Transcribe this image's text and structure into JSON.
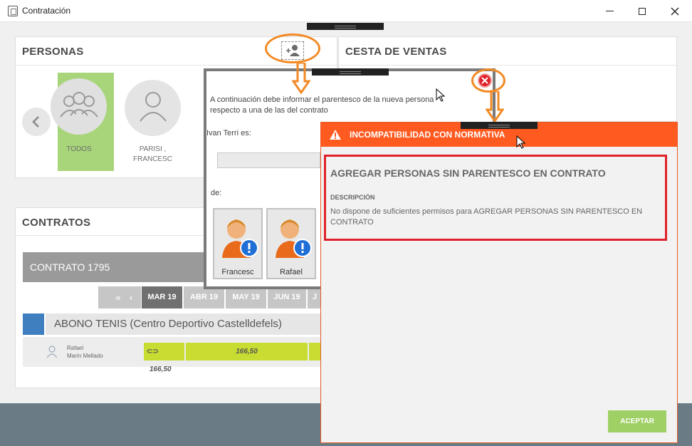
{
  "window": {
    "title": "Contratación",
    "minimize_icon": "minimize-icon",
    "maximize_icon": "maximize-icon",
    "close_icon": "close-icon"
  },
  "personas": {
    "title": "PERSONAS",
    "add_person_icon": "add-person-icon",
    "prev_icon": "chevron-left-icon",
    "tiles": [
      {
        "label": "TODOS",
        "icon": "group-icon",
        "selected": true
      },
      {
        "label_line1": "PARISI ,",
        "label_line2": "FRANCESC",
        "icon": "person-icon"
      }
    ]
  },
  "cesta": {
    "title": "CESTA DE VENTAS"
  },
  "contratos": {
    "title": "CONTRATOS",
    "contract_label": "CONTRATO 1795",
    "months": [
      "MAR 19",
      "ABR 19",
      "MAY 19",
      "JUN 19",
      "J"
    ],
    "active_month": "MAR 19",
    "service": "ABONO TENIS (Centro Deportivo Castelldefels)",
    "member_line1": "Rafael",
    "member_line2": "Marín Mellado",
    "amount_1": "166,50",
    "amount_2": "166,50",
    "colors": {
      "green_bar": "#c9dc31",
      "selected_tile": "#a8d57a"
    }
  },
  "parentesco_dialog": {
    "instruction_line1": "A continuación debe informar el parentesco de la nueva persona",
    "instruction_line2": "respecto a una de las del contrato",
    "person_line": "Ivan Terri  es:",
    "de_label": "de:",
    "close_icon": "error-close-icon",
    "relatives": [
      {
        "name": "Francesc",
        "icon": "user-alert-icon"
      },
      {
        "name": "Rafael",
        "icon": "user-alert-icon"
      }
    ]
  },
  "alert": {
    "header": "INCOMPATIBILIDAD CON NORMATIVA",
    "warning_icon": "warning-icon",
    "title": "AGREGAR PERSONAS SIN PARENTESCO EN CONTRATO",
    "description_label": "DESCRIPCIÓN",
    "description": "No dispone de suficientes permisos para AGREGAR PERSONAS SIN PARENTESCO EN CONTRATO",
    "accept_label": "ACEPTAR",
    "colors": {
      "header": "#ff5a1f",
      "border_highlight": "#e0222a",
      "accept": "#9fd065"
    }
  }
}
